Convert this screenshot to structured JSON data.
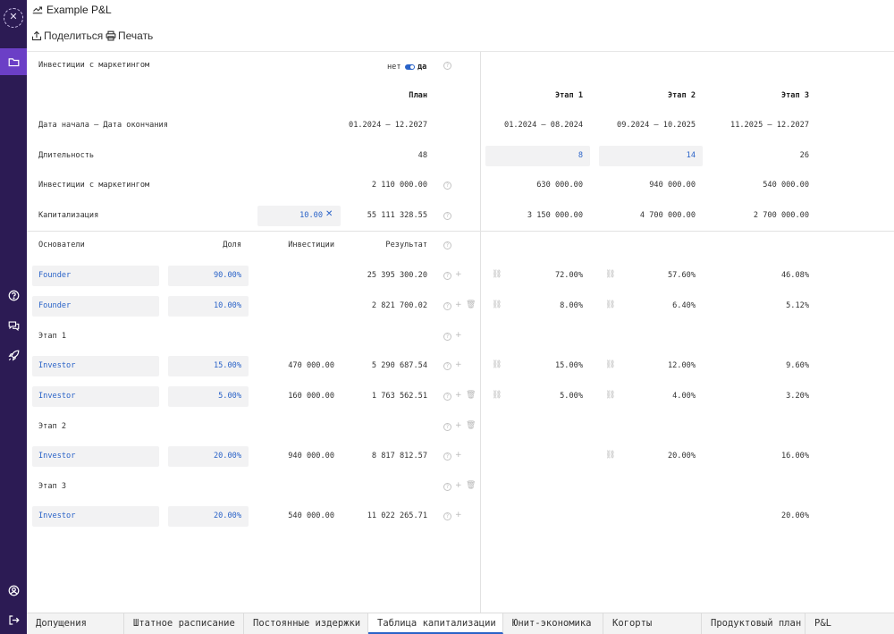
{
  "window": {
    "title": "Example P&L"
  },
  "toolbar": {
    "share_label": "Поделиться",
    "print_label": "Печать"
  },
  "sidebar": {
    "icons": [
      "logo-icon",
      "folder-icon",
      "help-icon",
      "chat-icon",
      "rocket-icon",
      "user-icon",
      "logout-icon"
    ]
  },
  "marketing_toggle": {
    "label": "Инвестиции с маркетингом",
    "off_label": "нет",
    "on_label": "да",
    "value": "да"
  },
  "columns": {
    "plan": "План",
    "stages": [
      "Этап 1",
      "Этап 2",
      "Этап 3"
    ]
  },
  "summary": {
    "dates": {
      "label": "Дата начала — Дата окончания",
      "plan": "01.2024 — 12.2027",
      "stages": [
        "01.2024 — 08.2024",
        "09.2024 — 10.2025",
        "11.2025 — 12.2027"
      ]
    },
    "duration": {
      "label": "Длительность",
      "plan": "48",
      "stages": [
        "8",
        "14",
        "26"
      ]
    },
    "investments": {
      "label": "Инвестиции с маркетингом",
      "plan": "2 110 000.00",
      "stages": [
        "630 000.00",
        "940 000.00",
        "540 000.00"
      ]
    },
    "capitalization": {
      "label": "Капитализация",
      "multiplier": "10.00",
      "plan": "55 111 328.55",
      "stages": [
        "3 150 000.00",
        "4 700 000.00",
        "2 700 000.00"
      ]
    }
  },
  "founders_header": {
    "name": "Основатели",
    "share": "Доля",
    "investment": "Инвестиции",
    "result": "Результат"
  },
  "rows": {
    "founder1": {
      "name": "Founder",
      "share": "90.00%",
      "investment": "",
      "result": "25 395 300.20",
      "stages": [
        "72.00%",
        "57.60%",
        "46.08%"
      ]
    },
    "founder2": {
      "name": "Founder",
      "share": "10.00%",
      "investment": "",
      "result": "2 821 700.02",
      "stages": [
        "8.00%",
        "6.40%",
        "5.12%"
      ]
    },
    "stage1_label": "Этап 1",
    "investor1": {
      "name": "Investor",
      "share": "15.00%",
      "investment": "470 000.00",
      "result": "5 290 687.54",
      "stages": [
        "15.00%",
        "12.00%",
        "9.60%"
      ]
    },
    "investor2": {
      "name": "Investor",
      "share": "5.00%",
      "investment": "160 000.00",
      "result": "1 763 562.51",
      "stages": [
        "5.00%",
        "4.00%",
        "3.20%"
      ]
    },
    "stage2_label": "Этап 2",
    "investor3": {
      "name": "Investor",
      "share": "20.00%",
      "investment": "940 000.00",
      "result": "8 817 812.57",
      "stages": [
        "",
        "20.00%",
        "16.00%"
      ]
    },
    "stage3_label": "Этап 3",
    "investor4": {
      "name": "Investor",
      "share": "20.00%",
      "investment": "540 000.00",
      "result": "11 022 265.71",
      "stages": [
        "",
        "",
        "20.00%"
      ]
    }
  },
  "tabs": [
    "Допущения",
    "Штатное расписание",
    "Постоянные издержки",
    "Таблица капитализации",
    "Юнит-экономика",
    "Когорты",
    "Продуктовый план",
    "P&L"
  ],
  "active_tab": "Таблица капитализации",
  "colors": {
    "sidebar": "#2c1b54",
    "sidebar_active": "#6b3fc6",
    "accent": "#2a63c8",
    "cell_bg": "#f2f2f3"
  }
}
